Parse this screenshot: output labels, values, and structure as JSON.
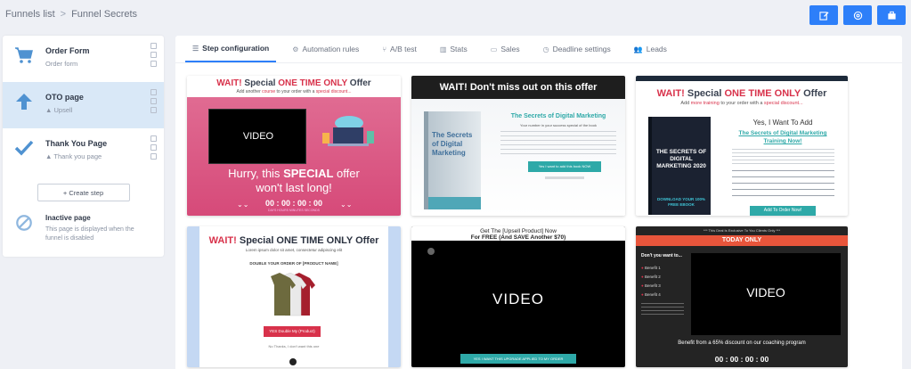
{
  "breadcrumb": {
    "root": "Funnels list",
    "separator": ">",
    "current": "Funnel Secrets"
  },
  "steps": [
    {
      "title": "Order Form",
      "type": "Order form"
    },
    {
      "title": "OTO page",
      "type": "Upsell"
    },
    {
      "title": "Thank You Page",
      "type": "Thank you page"
    }
  ],
  "create_step_label": "+ Create step",
  "inactive": {
    "title": "Inactive page",
    "description": "This page is displayed when the funnel is disabled"
  },
  "tabs": [
    {
      "label": "Step configuration"
    },
    {
      "label": "Automation rules"
    },
    {
      "label": "A/B test"
    },
    {
      "label": "Stats"
    },
    {
      "label": "Sales"
    },
    {
      "label": "Deadline settings"
    },
    {
      "label": "Leads"
    }
  ],
  "previews": {
    "p1": {
      "headline_a": "WAIT!",
      "headline_b": "Special",
      "headline_c": "ONE TIME ONLY",
      "headline_d": "Offer",
      "sub_a": "Add another",
      "sub_b": "course",
      "sub_c": "to your order with a",
      "sub_d": "special discount...",
      "video": "VIDEO",
      "text1": "Hurry, this",
      "text2": "SPECIAL",
      "text3": "offer",
      "text4": "won't last long!",
      "timer": "00 : 00 : 00 : 00",
      "timer_labels": "DAYS HOURS MINUTES SECONDS"
    },
    "p2": {
      "headline": "WAIT! Don't miss out on this offer",
      "book": "The Secrets of Digital Marketing",
      "title": "The Secrets of Digital Marketing",
      "sub": "Your number in your success special of the book",
      "button": "Yes I want to add this book NOW"
    },
    "p3": {
      "headline_a": "WAIT!",
      "headline_b": "Special",
      "headline_c": "ONE TIME ONLY",
      "headline_d": "Offer",
      "sub_a": "Add",
      "sub_b": "more training",
      "sub_c": "to your order with a",
      "sub_d": "special discount...",
      "book": "THE SECRETS OF DIGITAL MARKETING 2020",
      "book_cta": "DOWNLOAD YOUR 100% FREE EBOOK",
      "yes": "Yes, I Want To Add",
      "link1": "The Secrets of Digital Marketing",
      "link2": "Training Now!",
      "button": "Add To Order Now!"
    },
    "p4": {
      "headline_a": "WAIT!",
      "headline_b": "Special ONE TIME ONLY Offer",
      "sub": "Lorem ipsum dolor sit amet, consectetur adipiscing elit",
      "double": "DOUBLE YOUR ORDER OF [PRODUCT NAME]",
      "button": "YES Double My (Product)",
      "nothanks": "No Thanks, I don't want this one"
    },
    "p5": {
      "line1": "Get The [Upsell Product] Now",
      "line2": "For FREE (And SAVE Another $70)",
      "video": "VIDEO",
      "button": "YES I WANT THIS UPGRADE APPLIED TO MY ORDER"
    },
    "p6": {
      "topline": "*** This Deal Is Exclusive To You Clients Only ***",
      "banner": "TODAY ONLY",
      "want": "Don't you want to...",
      "b1": "Benefit 1",
      "b2": "Benefit 2",
      "b3": "Benefit 3",
      "b4": "Benefit 4",
      "video": "VIDEO",
      "benefit": "Benefit from a 65% discount on our coaching program",
      "timer": "00 : 00 : 00 : 00"
    }
  },
  "colors": {
    "accent": "#2d7ff9",
    "active_step": "#d9e8f7",
    "highlight_red": "#d8324b"
  }
}
